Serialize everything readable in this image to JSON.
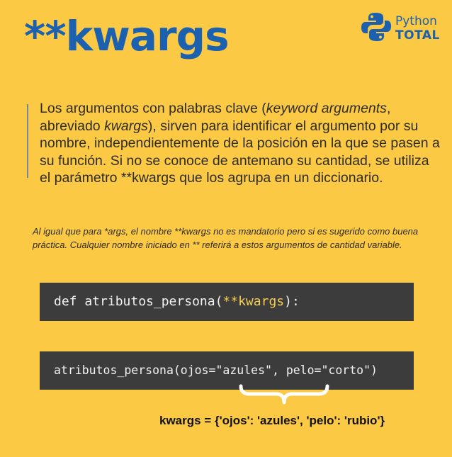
{
  "title": "**kwargs",
  "logo": {
    "line1": "Python",
    "line2": "TOTAL",
    "icon": "python-logo-icon",
    "color": "#1B61B0"
  },
  "intro": {
    "part1": "Los argumentos con palabras clave (",
    "italic1": "keyword arguments",
    "part2": ", abreviado ",
    "italic2": "kwargs",
    "part3": "), sirven para identificar el argumento por su nombre, independientemente de la posición en la que se pasen a su función. Si no se conoce de antemano su cantidad, se utiliza el parámetro **kwargs que los agrupa en un diccionario."
  },
  "note": "Al igual que para *args, el nombre **kwargs no es mandatorio pero si es sugerido como buena práctica. Cualquier nombre iniciado en ** referirá a estos argumentos de cantidad variable.",
  "code1": {
    "prefix": "def atributos_persona(",
    "highlight": "**kwargs",
    "suffix": "):"
  },
  "code2": "atributos_persona(ojos=\"azules\", pelo=\"corto\")",
  "result": "kwargs = {'ojos': 'azules', 'pelo': 'rubio'}",
  "colors": {
    "background": "#FCC945",
    "accent": "#1B61B0",
    "code_bg": "#3C3C3C",
    "code_highlight": "#F6CF52"
  }
}
